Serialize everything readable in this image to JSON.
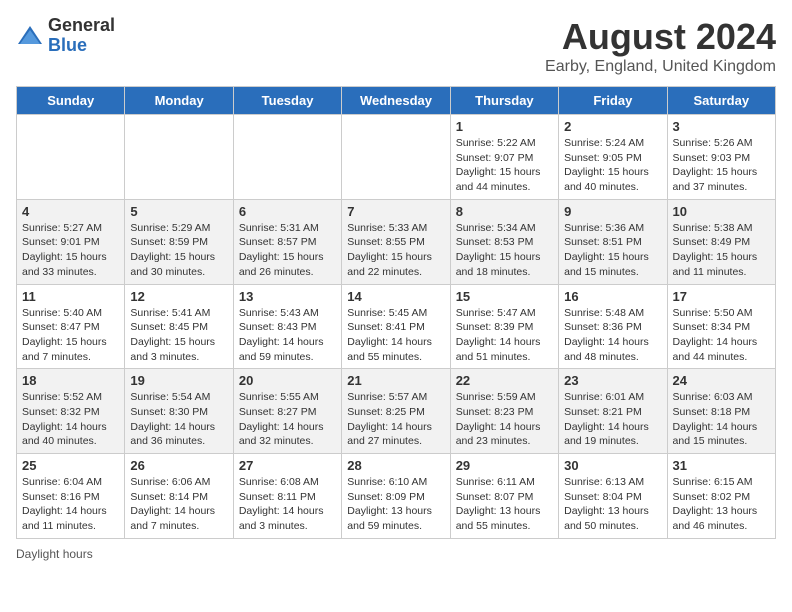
{
  "header": {
    "logo_general": "General",
    "logo_blue": "Blue",
    "title": "August 2024",
    "subtitle": "Earby, England, United Kingdom"
  },
  "columns": [
    "Sunday",
    "Monday",
    "Tuesday",
    "Wednesday",
    "Thursday",
    "Friday",
    "Saturday"
  ],
  "weeks": [
    [
      {
        "day": "",
        "info": ""
      },
      {
        "day": "",
        "info": ""
      },
      {
        "day": "",
        "info": ""
      },
      {
        "day": "",
        "info": ""
      },
      {
        "day": "1",
        "info": "Sunrise: 5:22 AM\nSunset: 9:07 PM\nDaylight: 15 hours\nand 44 minutes."
      },
      {
        "day": "2",
        "info": "Sunrise: 5:24 AM\nSunset: 9:05 PM\nDaylight: 15 hours\nand 40 minutes."
      },
      {
        "day": "3",
        "info": "Sunrise: 5:26 AM\nSunset: 9:03 PM\nDaylight: 15 hours\nand 37 minutes."
      }
    ],
    [
      {
        "day": "4",
        "info": "Sunrise: 5:27 AM\nSunset: 9:01 PM\nDaylight: 15 hours\nand 33 minutes."
      },
      {
        "day": "5",
        "info": "Sunrise: 5:29 AM\nSunset: 8:59 PM\nDaylight: 15 hours\nand 30 minutes."
      },
      {
        "day": "6",
        "info": "Sunrise: 5:31 AM\nSunset: 8:57 PM\nDaylight: 15 hours\nand 26 minutes."
      },
      {
        "day": "7",
        "info": "Sunrise: 5:33 AM\nSunset: 8:55 PM\nDaylight: 15 hours\nand 22 minutes."
      },
      {
        "day": "8",
        "info": "Sunrise: 5:34 AM\nSunset: 8:53 PM\nDaylight: 15 hours\nand 18 minutes."
      },
      {
        "day": "9",
        "info": "Sunrise: 5:36 AM\nSunset: 8:51 PM\nDaylight: 15 hours\nand 15 minutes."
      },
      {
        "day": "10",
        "info": "Sunrise: 5:38 AM\nSunset: 8:49 PM\nDaylight: 15 hours\nand 11 minutes."
      }
    ],
    [
      {
        "day": "11",
        "info": "Sunrise: 5:40 AM\nSunset: 8:47 PM\nDaylight: 15 hours\nand 7 minutes."
      },
      {
        "day": "12",
        "info": "Sunrise: 5:41 AM\nSunset: 8:45 PM\nDaylight: 15 hours\nand 3 minutes."
      },
      {
        "day": "13",
        "info": "Sunrise: 5:43 AM\nSunset: 8:43 PM\nDaylight: 14 hours\nand 59 minutes."
      },
      {
        "day": "14",
        "info": "Sunrise: 5:45 AM\nSunset: 8:41 PM\nDaylight: 14 hours\nand 55 minutes."
      },
      {
        "day": "15",
        "info": "Sunrise: 5:47 AM\nSunset: 8:39 PM\nDaylight: 14 hours\nand 51 minutes."
      },
      {
        "day": "16",
        "info": "Sunrise: 5:48 AM\nSunset: 8:36 PM\nDaylight: 14 hours\nand 48 minutes."
      },
      {
        "day": "17",
        "info": "Sunrise: 5:50 AM\nSunset: 8:34 PM\nDaylight: 14 hours\nand 44 minutes."
      }
    ],
    [
      {
        "day": "18",
        "info": "Sunrise: 5:52 AM\nSunset: 8:32 PM\nDaylight: 14 hours\nand 40 minutes."
      },
      {
        "day": "19",
        "info": "Sunrise: 5:54 AM\nSunset: 8:30 PM\nDaylight: 14 hours\nand 36 minutes."
      },
      {
        "day": "20",
        "info": "Sunrise: 5:55 AM\nSunset: 8:27 PM\nDaylight: 14 hours\nand 32 minutes."
      },
      {
        "day": "21",
        "info": "Sunrise: 5:57 AM\nSunset: 8:25 PM\nDaylight: 14 hours\nand 27 minutes."
      },
      {
        "day": "22",
        "info": "Sunrise: 5:59 AM\nSunset: 8:23 PM\nDaylight: 14 hours\nand 23 minutes."
      },
      {
        "day": "23",
        "info": "Sunrise: 6:01 AM\nSunset: 8:21 PM\nDaylight: 14 hours\nand 19 minutes."
      },
      {
        "day": "24",
        "info": "Sunrise: 6:03 AM\nSunset: 8:18 PM\nDaylight: 14 hours\nand 15 minutes."
      }
    ],
    [
      {
        "day": "25",
        "info": "Sunrise: 6:04 AM\nSunset: 8:16 PM\nDaylight: 14 hours\nand 11 minutes."
      },
      {
        "day": "26",
        "info": "Sunrise: 6:06 AM\nSunset: 8:14 PM\nDaylight: 14 hours\nand 7 minutes."
      },
      {
        "day": "27",
        "info": "Sunrise: 6:08 AM\nSunset: 8:11 PM\nDaylight: 14 hours\nand 3 minutes."
      },
      {
        "day": "28",
        "info": "Sunrise: 6:10 AM\nSunset: 8:09 PM\nDaylight: 13 hours\nand 59 minutes."
      },
      {
        "day": "29",
        "info": "Sunrise: 6:11 AM\nSunset: 8:07 PM\nDaylight: 13 hours\nand 55 minutes."
      },
      {
        "day": "30",
        "info": "Sunrise: 6:13 AM\nSunset: 8:04 PM\nDaylight: 13 hours\nand 50 minutes."
      },
      {
        "day": "31",
        "info": "Sunrise: 6:15 AM\nSunset: 8:02 PM\nDaylight: 13 hours\nand 46 minutes."
      }
    ]
  ],
  "footer": {
    "daylight_label": "Daylight hours"
  }
}
